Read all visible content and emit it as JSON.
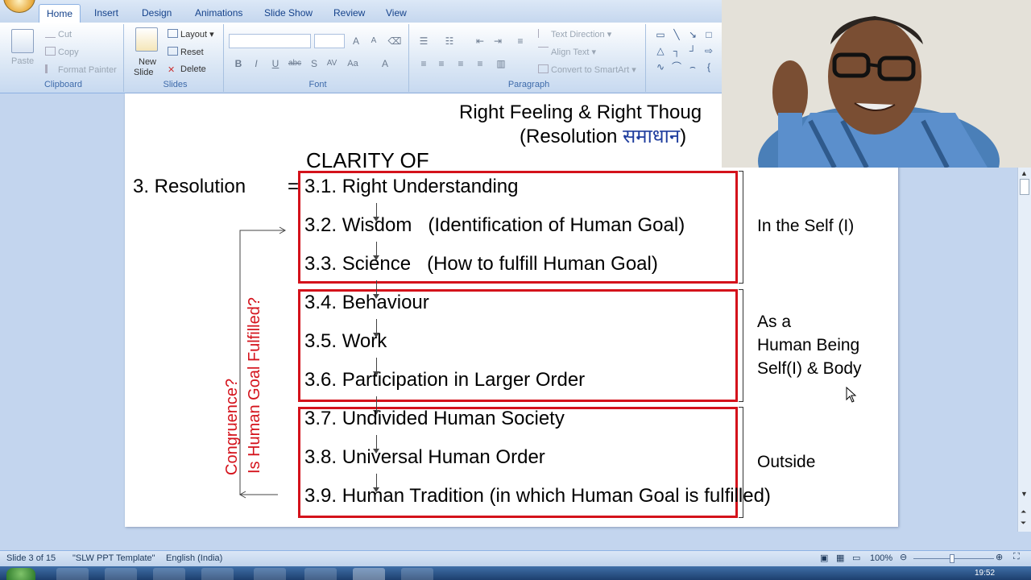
{
  "ribbon": {
    "tabs": [
      {
        "label": "Home",
        "active": true
      },
      {
        "label": "Insert"
      },
      {
        "label": "Design"
      },
      {
        "label": "Animations"
      },
      {
        "label": "Slide Show"
      },
      {
        "label": "Review"
      },
      {
        "label": "View"
      }
    ],
    "clipboard": {
      "paste": "Paste",
      "cut": "Cut",
      "copy": "Copy",
      "format_painter": "Format Painter",
      "label": "Clipboard"
    },
    "slides": {
      "new_slide_1": "New",
      "new_slide_2": "Slide",
      "layout": "Layout",
      "reset": "Reset",
      "delete": "Delete",
      "label": "Slides"
    },
    "font": {
      "label": "Font"
    },
    "paragraph": {
      "text_direction": "Text Direction",
      "align_text": "Align Text",
      "convert_smartart": "Convert to SmartArt",
      "label": "Paragraph"
    }
  },
  "slide": {
    "header_line1": "Right Feeling & Right Thoug",
    "header_line2_a": "(Resolution ",
    "header_line2_hindi": "समाधान",
    "header_line2_b": ")",
    "clarity": "CLARITY OF",
    "resolution_label": "3. Resolution",
    "equals": "=",
    "items": [
      "3.1. Right Understanding",
      "3.2. Wisdom   (Identification of Human Goal)",
      "3.3. Science   (How to fulfill Human Goal)",
      "3.4. Behaviour",
      "3.5. Work",
      "3.6. Participation in Larger Order",
      "3.7. Undivided Human Society",
      "3.8. Universal Human Order",
      "3.9. Human Tradition (in which Human Goal is fulfilled)"
    ],
    "group_labels": {
      "self": "In the Self (I)",
      "human_1": "As a",
      "human_2": "Human Being",
      "human_3": "Self(I) & Body",
      "outside": "Outside"
    },
    "side_label_1": "Congruence?",
    "side_label_2": "Is Human Goal Fulfilled?",
    "page_number": "3",
    "colors": {
      "box_red": "#d4121b",
      "hindi_blue": "#1f3d9e"
    }
  },
  "status": {
    "slide_info": "Slide 3 of 15",
    "template": "\"SLW PPT Template\"",
    "language": "English (India)",
    "zoom": "100%"
  },
  "taskbar": {
    "clock": "19:52"
  }
}
